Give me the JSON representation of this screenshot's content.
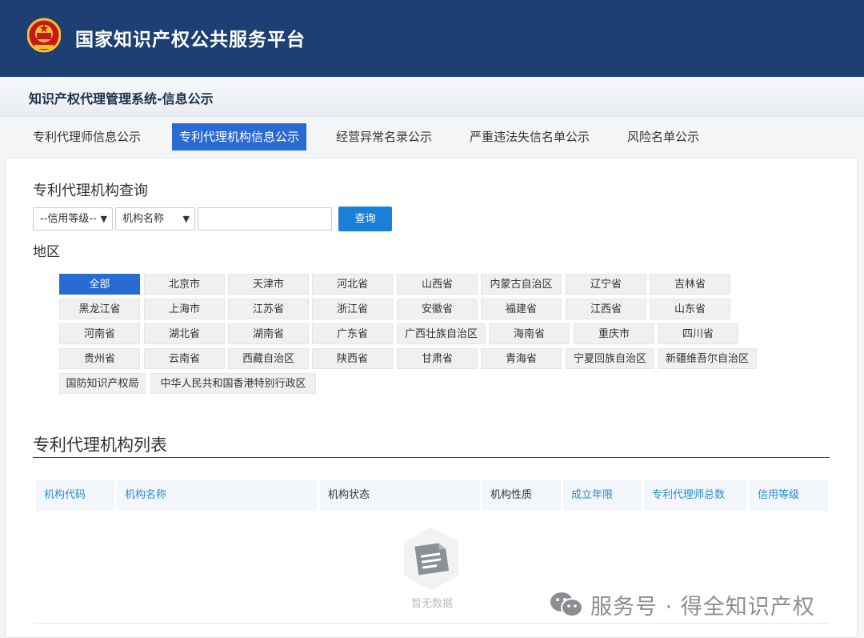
{
  "header": {
    "site_title": "国家知识产权公共服务平台",
    "subtitle": "知识产权代理管理系统-信息公示"
  },
  "tabs": [
    {
      "label": "专利代理师信息公示"
    },
    {
      "label": "专利代理机构信息公示"
    },
    {
      "label": "经营异常名录公示"
    },
    {
      "label": "严重违法失信名单公示"
    },
    {
      "label": "风险名单公示"
    }
  ],
  "search": {
    "title": "专利代理机构查询",
    "credit_select": "--信用等级--",
    "type_select": "机构名称",
    "input_value": "",
    "button": "查询"
  },
  "regions": {
    "title": "地区",
    "items": [
      "全部",
      "北京市",
      "天津市",
      "河北省",
      "山西省",
      "内蒙古自治区",
      "辽宁省",
      "吉林省",
      "黑龙江省",
      "上海市",
      "江苏省",
      "浙江省",
      "安徽省",
      "福建省",
      "江西省",
      "山东省",
      "河南省",
      "湖北省",
      "湖南省",
      "广东省",
      "广西壮族自治区",
      "海南省",
      "重庆市",
      "四川省",
      "贵州省",
      "云南省",
      "西藏自治区",
      "陕西省",
      "甘肃省",
      "青海省",
      "宁夏回族自治区",
      "新疆维吾尔自治区",
      "国防知识产权局",
      "中华人民共和国香港特别行政区"
    ],
    "selected": "全部"
  },
  "list": {
    "title": "专利代理机构列表",
    "columns": [
      "机构代码",
      "机构名称",
      "机构状态",
      "机构性质",
      "成立年限",
      "专利代理师总数",
      "信用等级"
    ],
    "empty_text": "暂无数据"
  },
  "watermark": {
    "text": "服务号 · 得全知识产权"
  },
  "colors": {
    "header_bg": "#1d3f73",
    "accent": "#2a6ad3",
    "button": "#1a7fd8",
    "link": "#2a8ad6"
  }
}
